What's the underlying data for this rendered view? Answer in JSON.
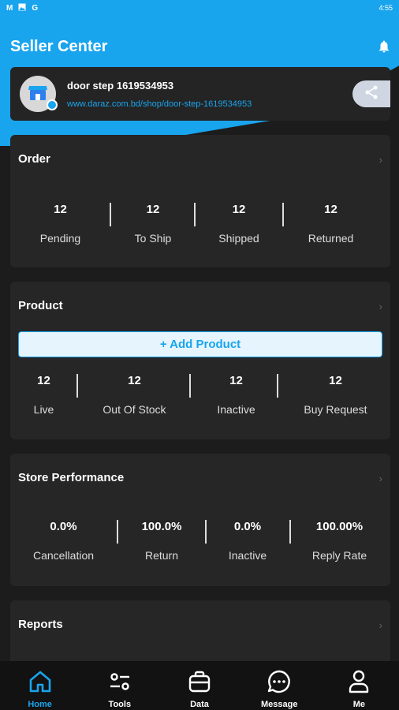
{
  "status_bar": {
    "icons": [
      "M",
      "img",
      "G"
    ],
    "time": "4:55"
  },
  "header": {
    "title": "Seller Center"
  },
  "shop": {
    "name": "door step 1619534953",
    "url": "www.daraz.com.bd/shop/door-step-1619534953"
  },
  "order": {
    "title": "Order",
    "stats": [
      {
        "value": "12",
        "label": "Pending"
      },
      {
        "value": "12",
        "label": "To Ship"
      },
      {
        "value": "12",
        "label": "Shipped"
      },
      {
        "value": "12",
        "label": "Returned"
      }
    ]
  },
  "product": {
    "title": "Product",
    "add_label": "+ Add Product",
    "stats": [
      {
        "value": "12",
        "label": "Live"
      },
      {
        "value": "12",
        "label": "Out Of Stock"
      },
      {
        "value": "12",
        "label": "Inactive"
      },
      {
        "value": "12",
        "label": "Buy Request"
      }
    ]
  },
  "performance": {
    "title": "Store Performance",
    "stats": [
      {
        "value": "0.0%",
        "label": "Cancellation"
      },
      {
        "value": "100.0%",
        "label": "Return"
      },
      {
        "value": "0.0%",
        "label": "Inactive"
      },
      {
        "value": "100.00%",
        "label": "Reply Rate"
      }
    ]
  },
  "reports": {
    "title": "Reports"
  },
  "nav": {
    "active_color": "#19a4ee",
    "items": [
      {
        "label": "Home",
        "icon": "home-icon"
      },
      {
        "label": "Tools",
        "icon": "tools-icon"
      },
      {
        "label": "Data",
        "icon": "data-icon"
      },
      {
        "label": "Message",
        "icon": "message-icon"
      },
      {
        "label": "Me",
        "icon": "me-icon"
      }
    ]
  }
}
